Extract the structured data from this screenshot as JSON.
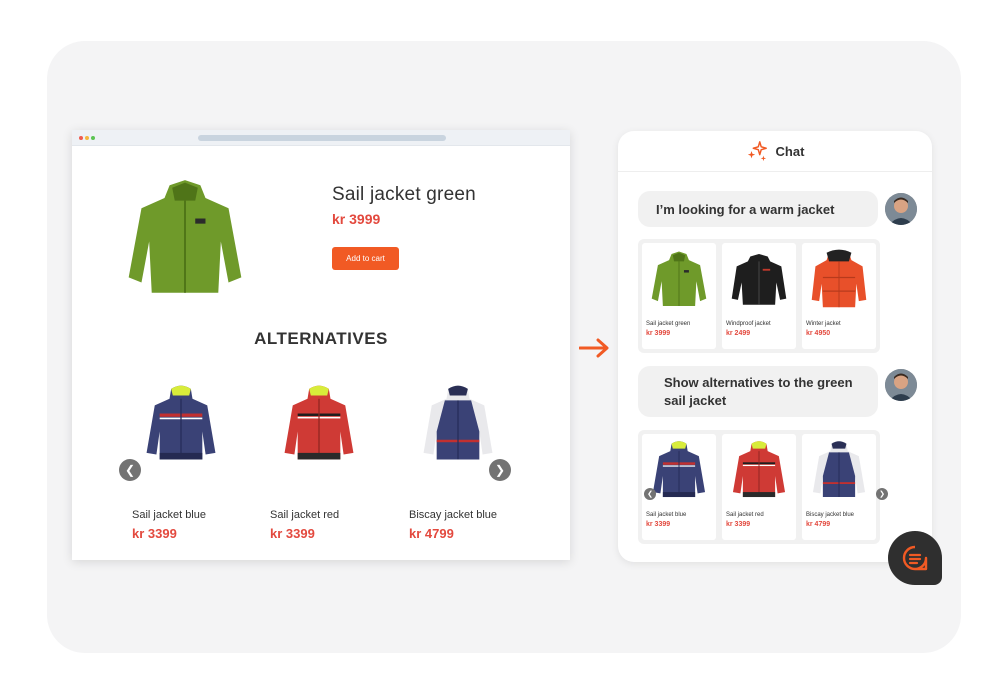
{
  "product": {
    "title": "Sail jacket green",
    "price": "kr 3999",
    "add_to_cart": "Add to cart"
  },
  "alternatives": {
    "heading": "ALTERNATIVES",
    "items": [
      {
        "name": "Sail jacket blue",
        "price": "kr 3399"
      },
      {
        "name": "Sail jacket red",
        "price": "kr 3399"
      },
      {
        "name": "Biscay jacket blue",
        "price": "kr 4799"
      }
    ]
  },
  "chat": {
    "title": "Chat",
    "messages": [
      {
        "text": "I’m looking for a warm jacket"
      },
      {
        "text": "Show alternatives to the green sail jacket"
      }
    ],
    "results_1": [
      {
        "name": "Sail jacket green",
        "price": "kr 3999"
      },
      {
        "name": "Windproof jacket",
        "price": "kr 2499"
      },
      {
        "name": "Winter jacket",
        "price": "kr 4950"
      }
    ],
    "results_2": [
      {
        "name": "Sail jacket blue",
        "price": "kr 3399"
      },
      {
        "name": "Sail jacket red",
        "price": "kr 3399"
      },
      {
        "name": "Biscay jacket blue",
        "price": "kr 4799"
      }
    ]
  },
  "colors": {
    "accent": "#f15a24",
    "price": "#e3493e"
  }
}
